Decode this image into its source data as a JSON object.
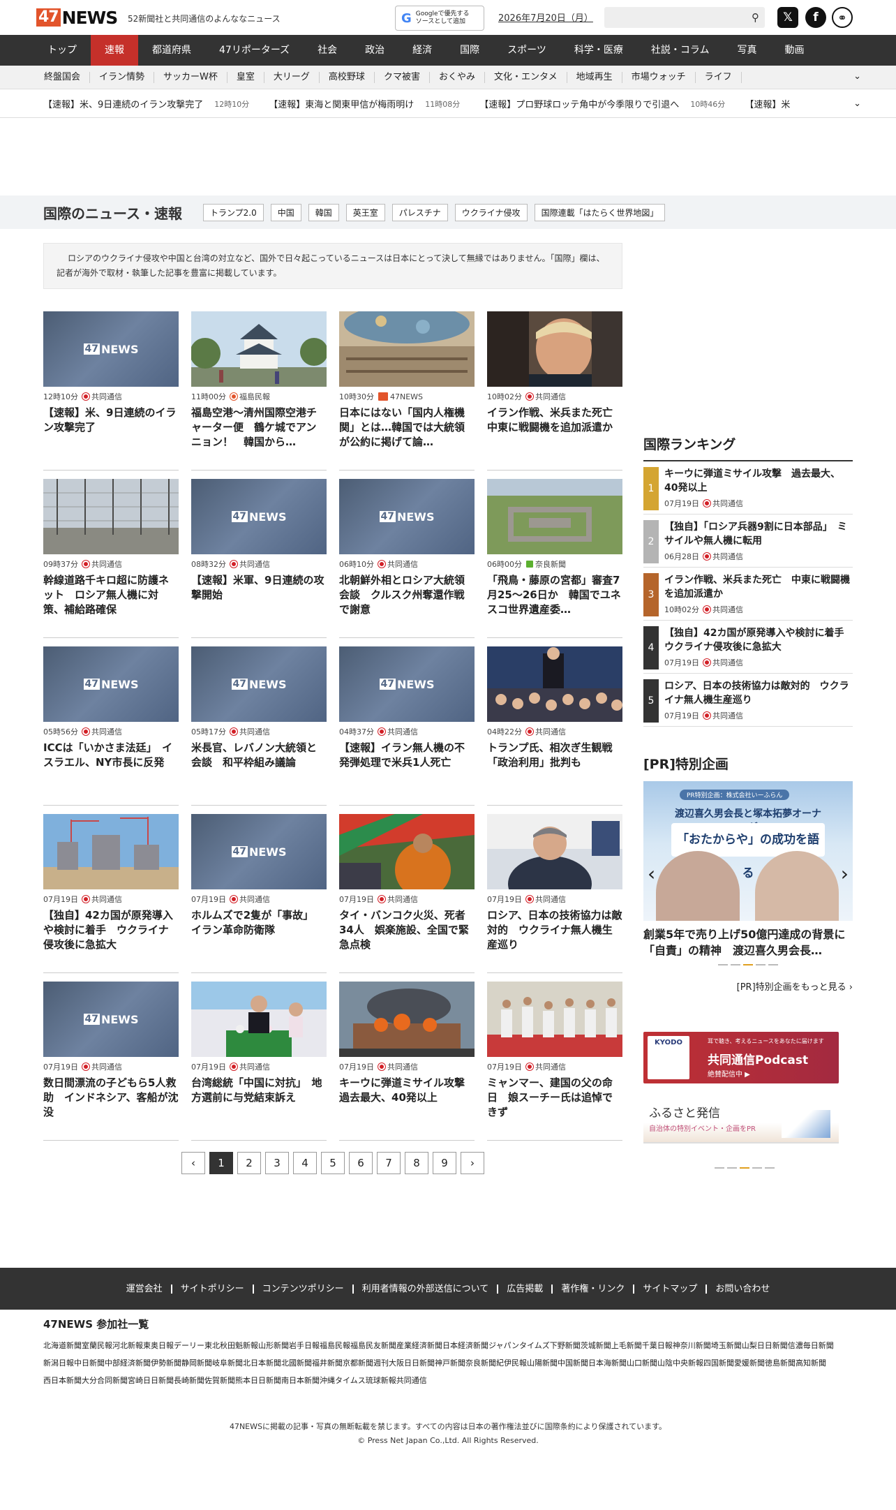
{
  "header": {
    "logo_box": "47",
    "logo_word": "NEWS",
    "tagline": "52新聞社と共同通信のよんななニュース",
    "google_source_1": "Googleで優先する",
    "google_source_2": "ソースとして追加",
    "date": "2026年7月20日（月）",
    "search_placeholder": ""
  },
  "main_nav": [
    "トップ",
    "速報",
    "都道府県",
    "47リポーターズ",
    "社会",
    "政治",
    "経済",
    "国際",
    "スポーツ",
    "科学・医療",
    "社説・コラム",
    "写真",
    "動画"
  ],
  "main_nav_active": "速報",
  "sub_nav": [
    "終盤国会",
    "イラン情勢",
    "サッカーW杯",
    "皇室",
    "大リーグ",
    "高校野球",
    "クマ被害",
    "おくやみ",
    "文化・エンタメ",
    "地域再生",
    "市場ウォッチ",
    "ライフ"
  ],
  "ticker": [
    {
      "text": "【速報】米、9日連続のイラン攻撃完了",
      "time": "12時10分"
    },
    {
      "text": "【速報】東海と関東甲信が梅雨明け",
      "time": "11時08分"
    },
    {
      "text": "【速報】プロ野球ロッテ角中が今季限りで引退へ",
      "time": "10時46分"
    },
    {
      "text": "【速報】米",
      "time": ""
    }
  ],
  "section": {
    "title": "国際のニュース・速報",
    "tags": [
      "トランプ2.0",
      "中国",
      "韓国",
      "英王室",
      "パレスチナ",
      "ウクライナ侵攻",
      "国際連載「はたらく世界地図」"
    ],
    "intro": "ロシアのウクライナ侵攻や中国と台湾の対立など、国外で日々起こっているニュースは日本にとって決して無縁ではありません。「国際」欄は、記者が海外で取材・執筆した記事を豊富に掲載しています。"
  },
  "placeholder_logo": "NEWS",
  "articles": [
    {
      "time": "12時10分",
      "source": "共同通信",
      "src": "kyodo",
      "title": "【速報】米、9日連続のイラン攻撃完了",
      "img": "ph"
    },
    {
      "time": "11時00分",
      "source": "福島民報",
      "src": "fk",
      "title": "福島空港〜清州国際空港チャーター便　鶴ケ城でアンニョン！　韓国から…",
      "img": "castle"
    },
    {
      "time": "10時30分",
      "source": "47NEWS",
      "src": "n47",
      "title": "日本にはない「国内人権機関」とは…韓国では大統領が公約に掲げて論…",
      "img": "un"
    },
    {
      "time": "10時02分",
      "source": "共同通信",
      "src": "kyodo",
      "title": "イラン作戦、米兵また死亡　中東に戦闘機を追加派遣か",
      "img": "trump"
    },
    {
      "time": "09時37分",
      "source": "共同通信",
      "src": "kyodo",
      "title": "幹線道路千キロ超に防護ネット　ロシア無人機に対策、補給路確保",
      "img": "net"
    },
    {
      "time": "08時32分",
      "source": "共同通信",
      "src": "kyodo",
      "title": "【速報】米軍、9日連続の攻撃開始",
      "img": "ph"
    },
    {
      "time": "06時10分",
      "source": "共同通信",
      "src": "kyodo",
      "title": "北朝鮮外相とロシア大統領会談　クルスク州奪還作戦で謝意",
      "img": "ph"
    },
    {
      "time": "06時00分",
      "source": "奈良新聞",
      "src": "nr",
      "title": "「飛鳥・藤原の宮都」審査7月25〜26日か　韓国でユネスコ世界遺産委…",
      "img": "ruins"
    },
    {
      "time": "05時56分",
      "source": "共同通信",
      "src": "kyodo",
      "title": "ICCは「いかさま法廷」　イスラエル、NY市長に反発",
      "img": "ph"
    },
    {
      "time": "05時17分",
      "source": "共同通信",
      "src": "kyodo",
      "title": "米長官、レバノン大統領と会談　和平枠組み議論",
      "img": "ph"
    },
    {
      "time": "04時37分",
      "source": "共同通信",
      "src": "kyodo",
      "title": "【速報】イラン無人機の不発弾処理で米兵1人死亡",
      "img": "ph"
    },
    {
      "time": "04時22分",
      "source": "共同通信",
      "src": "kyodo",
      "title": "トランプ氏、相次ぎ生観戦　「政治利用」批判も",
      "img": "crowd"
    },
    {
      "time": "07月19日",
      "source": "共同通信",
      "src": "kyodo",
      "title": "【独自】42カ国が原発導入や検討に着手　ウクライナ侵攻後に急拡大",
      "img": "plant"
    },
    {
      "time": "07月19日",
      "source": "共同通信",
      "src": "kyodo",
      "title": "ホルムズで2隻が「事故」　イラン革命防衛隊",
      "img": "ph"
    },
    {
      "time": "07月19日",
      "source": "共同通信",
      "src": "kyodo",
      "title": "タイ・バンコク火災、死者34人　娯楽施設、全国で緊急点検",
      "img": "monk"
    },
    {
      "time": "07月19日",
      "source": "共同通信",
      "src": "kyodo",
      "title": "ロシア、日本の技術協力は敵対的　ウクライナ無人機生産巡り",
      "img": "official"
    },
    {
      "time": "07月19日",
      "source": "共同通信",
      "src": "kyodo",
      "title": "数日間漂流の子どもら5人救助　インドネシア、客船が沈没",
      "img": "ph"
    },
    {
      "time": "07月19日",
      "source": "共同通信",
      "src": "kyodo",
      "title": "台湾総統「中国に対抗」　地方選前に与党結束訴え",
      "img": "taiwan"
    },
    {
      "time": "07月19日",
      "source": "共同通信",
      "src": "kyodo",
      "title": "キーウに弾道ミサイル攻撃　過去最大、40発以上",
      "img": "fire"
    },
    {
      "time": "07月19日",
      "source": "共同通信",
      "src": "kyodo",
      "title": "ミャンマー、建国の父の命日　娘スーチー氏は追悼できず",
      "img": "myanmar"
    }
  ],
  "pagination": {
    "prev": "‹",
    "pages": [
      "1",
      "2",
      "3",
      "4",
      "5",
      "6",
      "7",
      "8",
      "9"
    ],
    "current": "1",
    "next": "›"
  },
  "ranking": {
    "title": "国際ランキング",
    "items": [
      {
        "num": "1",
        "title": "キーウに弾道ミサイル攻撃　過去最大、40発以上",
        "date": "07月19日",
        "source": "共同通信",
        "color": "#d4a532"
      },
      {
        "num": "2",
        "title": "【独自】「ロシア兵器9割に日本部品」　ミサイルや無人機に転用",
        "date": "06月28日",
        "source": "共同通信",
        "color": "#b4b4b4"
      },
      {
        "num": "3",
        "title": "イラン作戦、米兵また死亡　中東に戦闘機を追加派遣か",
        "date": "10時02分",
        "source": "共同通信",
        "color": "#b5652b"
      },
      {
        "num": "4",
        "title": "【独自】42カ国が原発導入や検討に着手　ウクライナ侵攻後に急拡大",
        "date": "07月19日",
        "source": "共同通信",
        "color": "#333333"
      },
      {
        "num": "5",
        "title": "ロシア、日本の技術協力は敵対的　ウクライナ無人機生産巡り",
        "date": "07月19日",
        "source": "共同通信",
        "color": "#333333"
      }
    ]
  },
  "pr": {
    "title": "[PR]特別企画",
    "banner_top": "PR特別企画：株式会社いーふらん",
    "banner_sub": "渡辺喜久男会長と塚本拓夢オーナーが",
    "banner_main": "「おたからや」の成功を語る",
    "article_title": "創業5年で売り上げ50億円達成の背景に「自責」の精神　渡辺喜久男会長…",
    "more": "[PR]特別企画をもっと見る ›",
    "prev": "‹",
    "next": "›"
  },
  "podcast": {
    "brand": "KYODO",
    "sub": "耳で聴き、考えるニュースをあなたに届けます",
    "title": "共同通信Podcast",
    "note": "絶賛配信中 ▶"
  },
  "furusato": {
    "title": "ふるさと発信",
    "sub": "自治体の特別イベント・企画をPR"
  },
  "footer_links": [
    "運営会社",
    "サイトポリシー",
    "コンテンツポリシー",
    "利用者情報の外部送信について",
    "広告掲載",
    "著作権・リンク",
    "サイトマップ",
    "お問い合わせ"
  ],
  "members": {
    "title": "47NEWS 参加社一覧",
    "list": [
      "北海道新聞",
      "室蘭民報",
      "河北新報",
      "東奥日報",
      "デーリー東北",
      "秋田魁新報",
      "山形新聞",
      "岩手日報",
      "福島民報",
      "福島民友新聞",
      "産業経済新聞",
      "日本経済新聞",
      "ジャパンタイムズ",
      "下野新聞",
      "茨城新聞",
      "上毛新聞",
      "千葉日報",
      "神奈川新聞",
      "埼玉新聞",
      "山梨日日新聞",
      "信濃毎日新聞",
      "新潟日報",
      "中日新聞",
      "中部経済新聞",
      "伊勢新聞",
      "静岡新聞",
      "岐阜新聞",
      "北日本新聞",
      "北國新聞",
      "福井新聞",
      "京都新聞",
      "週刊大阪日日新聞",
      "神戸新聞",
      "奈良新聞",
      "紀伊民報",
      "山陽新聞",
      "中国新聞",
      "日本海新聞",
      "山口新聞",
      "山陰中央新報",
      "四国新聞",
      "愛媛新聞",
      "徳島新聞",
      "高知新聞",
      "西日本新聞",
      "大分合同新聞",
      "宮崎日日新聞",
      "長崎新聞",
      "佐賀新聞",
      "熊本日日新聞",
      "南日本新聞",
      "沖縄タイムス",
      "琉球新報",
      "共同通信"
    ]
  },
  "copyright": {
    "line1": "47NEWSに掲載の記事・写真の無断転載を禁じます。すべての内容は日本の著作権法並びに国際条約により保護されています。",
    "line2": "© Press Net Japan Co.,Ltd. All Rights Reserved."
  }
}
